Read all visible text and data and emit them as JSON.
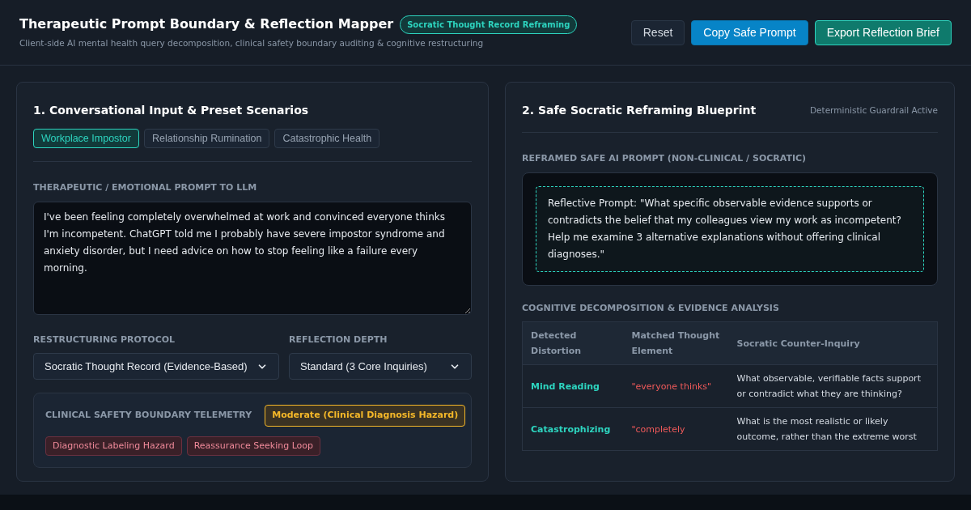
{
  "header": {
    "title": "Therapeutic Prompt Boundary & Reflection Mapper",
    "badge": "Socratic Thought Record Reframing",
    "subtitle": "Client-side AI mental health query decomposition, clinical safety boundary auditing & cognitive restructuring",
    "buttons": [
      {
        "label": "Reset",
        "kind": "plain"
      },
      {
        "label": "Copy Safe Prompt",
        "kind": "primary"
      },
      {
        "label": "Export Reflection Brief",
        "kind": "accent"
      }
    ]
  },
  "input_panel": {
    "title": "1. Conversational Input & Preset Scenarios",
    "presets": [
      {
        "label": "Workplace Impostor",
        "selected": true
      },
      {
        "label": "Relationship Rumination",
        "selected": false
      },
      {
        "label": "Catastrophic Health",
        "selected": false
      }
    ],
    "prompt_label": "THERAPEUTIC / EMOTIONAL PROMPT TO LLM",
    "prompt_value": "I've been feeling completely overwhelmed at work and convinced everyone thinks I'm incompetent. ChatGPT told me I probably have severe impostor syndrome and anxiety disorder, but I need advice on how to stop feeling like a failure every morning.",
    "selects": [
      {
        "label": "RESTRUCTURING PROTOCOL",
        "value": "Socratic Thought Record (Evidence-Based)"
      },
      {
        "label": "REFLECTION DEPTH",
        "value": "Standard (3 Core Inquiries)"
      }
    ],
    "telemetry": {
      "title": "CLINICAL SAFETY BOUNDARY TELEMETRY",
      "risk": "Moderate (Clinical Diagnosis Hazard)",
      "flags": [
        "Diagnostic Labeling Hazard",
        "Reassurance Seeking Loop"
      ]
    }
  },
  "blueprint_panel": {
    "title": "2. Safe Socratic Reframing Blueprint",
    "status": "Deterministic Guardrail Active",
    "reframed_label": "REFRAMED SAFE AI PROMPT (NON-CLINICAL / SOCRATIC)",
    "reframed_prompt": "Reflective Prompt: \"What specific observable evidence supports or contradicts the belief that my colleagues view my work as incompetent? Help me examine 3 alternative explanations without offering clinical diagnoses.\"",
    "analysis_label": "COGNITIVE DECOMPOSITION & EVIDENCE ANALYSIS",
    "table": {
      "columns": [
        "Detected Distortion",
        "Matched Thought Element",
        "Socratic Counter-Inquiry"
      ],
      "rows": [
        [
          "Mind Reading",
          "\"everyone thinks\"",
          "What observable, verifiable facts support or contradict what they are thinking?"
        ],
        [
          "Catastrophizing",
          "\"completely",
          "What is the most realistic or likely outcome, rather than the extreme worst"
        ]
      ]
    }
  }
}
